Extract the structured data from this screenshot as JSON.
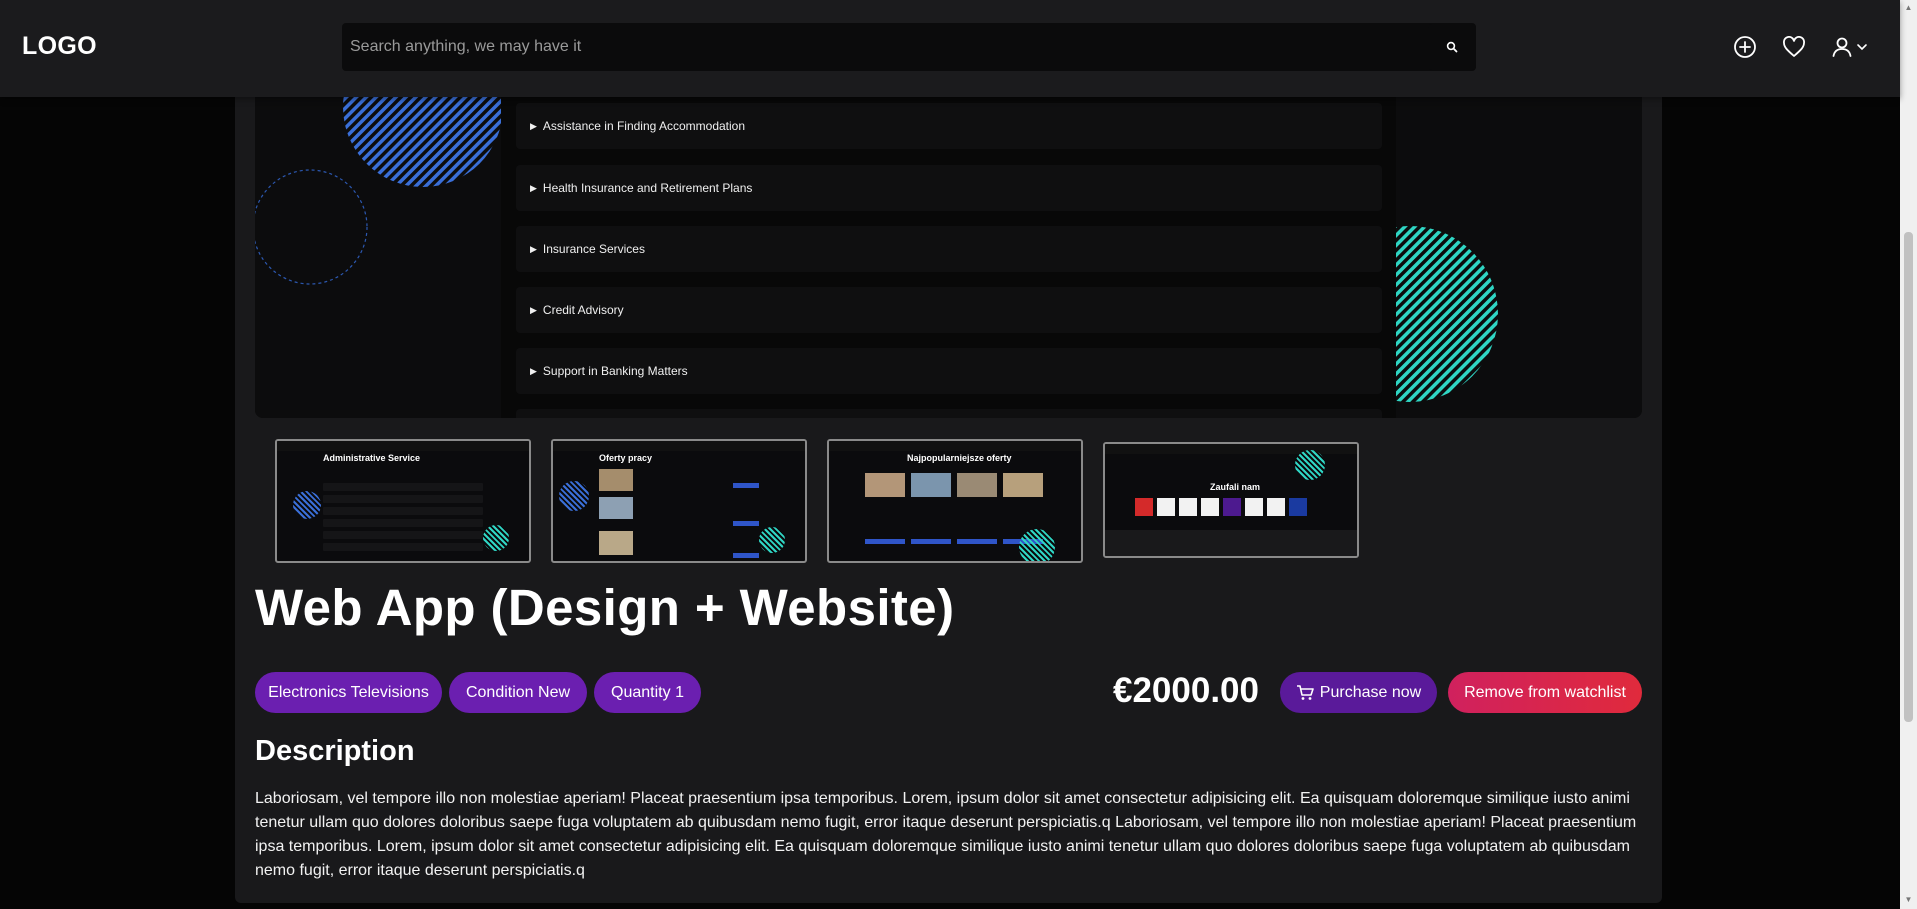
{
  "header": {
    "logo": "LOGO",
    "search_placeholder": "Search anything, we may have it"
  },
  "hero": {
    "accordion_items": [
      "Assistance in Finding Accommodation",
      "Health Insurance and Retirement Plans",
      "Insurance Services",
      "Credit Advisory",
      "Support in Banking Matters"
    ]
  },
  "thumbnails": [
    {
      "title": "Administrative Service"
    },
    {
      "title": "Oferty pracy"
    },
    {
      "title": "Najpopularniejsze oferty"
    },
    {
      "title": "Zaufali nam"
    }
  ],
  "product": {
    "title": "Web App (Design + Website)",
    "tags": [
      "Electronics Televisions",
      "Condition New",
      "Quantity 1"
    ],
    "price": "€2000.00",
    "purchase_label": "Purchase now",
    "remove_label": "Remove from watchlist"
  },
  "description": {
    "heading": "Description",
    "text": "Laboriosam, vel tempore illo non molestiae aperiam! Placeat praesentium ipsa temporibus. Lorem, ipsum dolor sit amet consectetur adipisicing elit. Ea quisquam doloremque similique iusto animi tenetur ullam quo dolores doloribus saepe fuga voluptatem ab quibusdam nemo fugit, error itaque deserunt perspiciatis.q Laboriosam, vel tempore illo non molestiae aperiam! Placeat praesentium ipsa temporibus. Lorem, ipsum dolor sit amet consectetur adipisicing elit. Ea quisquam doloremque similique iusto animi tenetur ullam quo dolores doloribus saepe fuga voluptatem ab quibusdam nemo fugit, error itaque deserunt perspiciatis.q"
  },
  "colors": {
    "accent_purple": "#6b1fb0",
    "remove_red": "#dd2650",
    "stripe_blue": "#3a6fd8",
    "stripe_teal": "#2fd6c4"
  }
}
